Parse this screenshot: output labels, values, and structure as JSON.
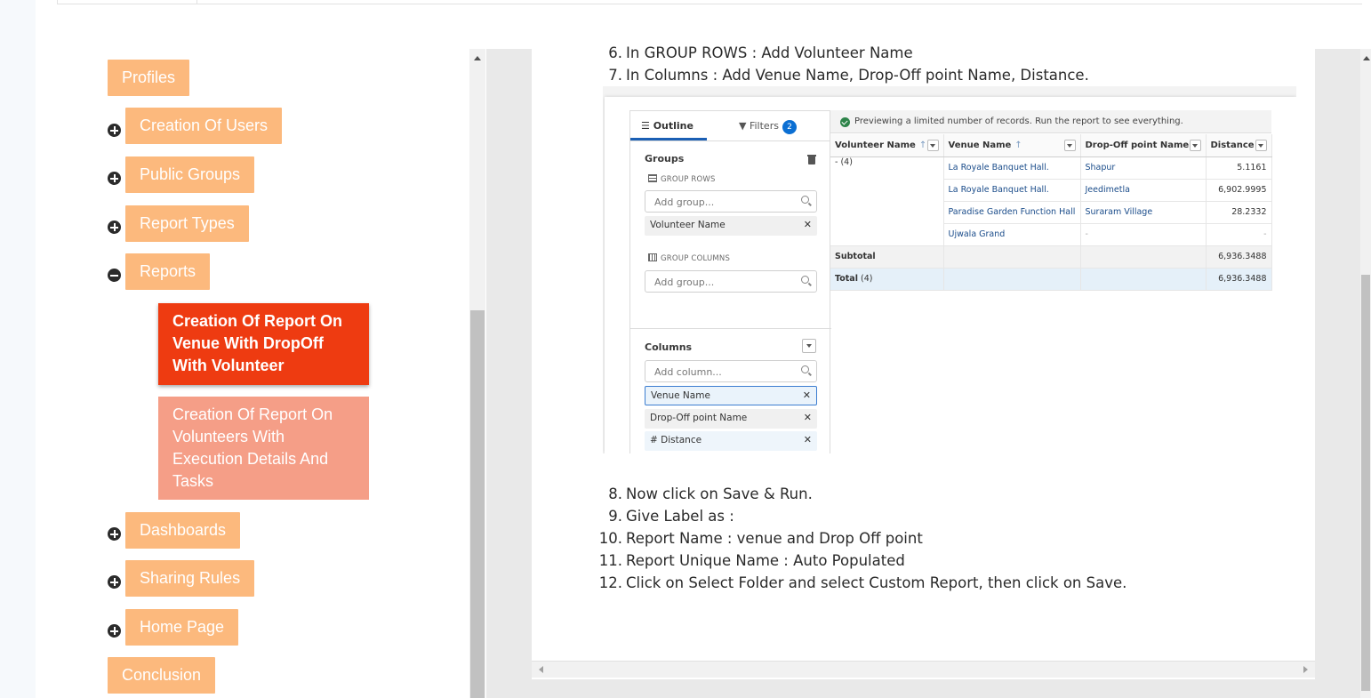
{
  "sidebar": {
    "top_items": [
      {
        "label": "Profiles",
        "expander": "none"
      },
      {
        "label": "Creation Of Users",
        "expander": "plus"
      },
      {
        "label": "Public Groups",
        "expander": "plus"
      },
      {
        "label": "Report Types",
        "expander": "plus"
      },
      {
        "label": "Reports",
        "expander": "minus"
      }
    ],
    "reports_children": [
      {
        "label": "Creation Of Report On Venue With DropOff With Volunteer",
        "state": "active"
      },
      {
        "label": "Creation Of Report On Volunteers With Execution Details And Tasks",
        "state": "inactive"
      }
    ],
    "bottom_items": [
      {
        "label": "Dashboards",
        "expander": "plus"
      },
      {
        "label": "Sharing Rules",
        "expander": "plus"
      },
      {
        "label": "Home Page",
        "expander": "plus"
      },
      {
        "label": "Conclusion",
        "expander": "none"
      }
    ]
  },
  "steps_before": [
    {
      "num": "6.",
      "text": "In GROUP ROWS : Add Volunteer Name"
    },
    {
      "num": "7.",
      "text": "In Columns : Add Venue Name, Drop-Off point Name, Distance."
    }
  ],
  "steps_after": [
    {
      "num": "8.",
      "text": "Now click on Save & Run."
    },
    {
      "num": "9.",
      "text": "Give Label as :"
    },
    {
      "num": "10.",
      "text": "Report Name : venue and Drop Off point"
    },
    {
      "num": "11.",
      "text": "Report Unique Name : Auto Populated"
    },
    {
      "num": "12.",
      "text": "Click on Select Folder and select Custom Report, then click on Save."
    }
  ],
  "report_builder": {
    "tabs": {
      "outline": "Outline",
      "filters": "Filters",
      "filters_count": "2"
    },
    "groups_title": "Groups",
    "group_rows_label": "GROUP ROWS",
    "group_rows_placeholder": "Add group...",
    "group_rows_items": [
      "Volunteer Name"
    ],
    "group_columns_label": "GROUP COLUMNS",
    "group_columns_placeholder": "Add group...",
    "columns_title": "Columns",
    "columns_placeholder": "Add column...",
    "columns_items": [
      "Venue Name",
      "Drop-Off point Name",
      "# Distance"
    ],
    "preview_notice": "Previewing a limited number of records. Run the report to see everything.",
    "table": {
      "headers": [
        "Volunteer Name",
        "Venue Name",
        "Drop-Off point Name",
        "Distance"
      ],
      "group_label": "- (4)",
      "rows": [
        {
          "venue": "La Royale Banquet Hall.",
          "dropoff": "Shapur",
          "distance": "5.1161"
        },
        {
          "venue": "La Royale Banquet Hall.",
          "dropoff": "Jeedimetla",
          "distance": "6,902.9995"
        },
        {
          "venue": "Paradise Garden Function Hall",
          "dropoff": "Suraram Village",
          "distance": "28.2332"
        },
        {
          "venue": "Ujwala Grand",
          "dropoff": "-",
          "distance": "-"
        }
      ],
      "subtotal_label": "Subtotal",
      "subtotal_value": "6,936.3488",
      "total_label": "Total",
      "total_count": "(4)",
      "total_value": "6,936.3488"
    }
  },
  "colors": {
    "nav_button": "#fcb97d",
    "active_child": "#ee3b11",
    "inactive_child": "#f59e87",
    "accent_blue": "#1b5fb4"
  }
}
